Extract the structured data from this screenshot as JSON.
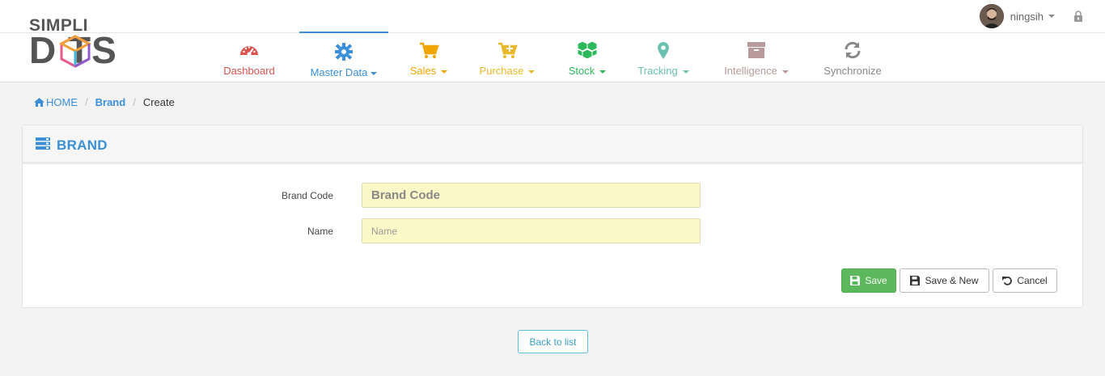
{
  "logo": {
    "line1": "SIMPLI",
    "line2": "D  TS"
  },
  "user": {
    "name": "ningsih"
  },
  "nav": {
    "items": [
      {
        "label": "Dashboard",
        "color": "#d9534f",
        "icon": "dashboard-gauge-icon",
        "dropdown": false
      },
      {
        "label": "Master Data",
        "color": "#3a8fd6",
        "icon": "gear-icon",
        "dropdown": true
      },
      {
        "label": "Sales",
        "color": "#f0a500",
        "icon": "cart-icon",
        "dropdown": true
      },
      {
        "label": "Purchase",
        "color": "#e8b92c",
        "icon": "cart-plus-icon",
        "dropdown": true
      },
      {
        "label": "Stock",
        "color": "#2db85c",
        "icon": "cubes-icon",
        "dropdown": true
      },
      {
        "label": "Tracking",
        "color": "#6cc0b0",
        "icon": "map-marker-icon",
        "dropdown": true
      },
      {
        "label": "Intelligence",
        "color": "#b89a9a",
        "icon": "archive-box-icon",
        "dropdown": true
      },
      {
        "label": "Synchronize",
        "color": "#888888",
        "icon": "refresh-icon",
        "dropdown": false
      }
    ]
  },
  "breadcrumb": {
    "home": "HOME",
    "section": "Brand",
    "current": "Create"
  },
  "panel": {
    "title": "BRAND"
  },
  "form": {
    "brand_code": {
      "label": "Brand Code",
      "placeholder": "Brand Code",
      "value": ""
    },
    "name": {
      "label": "Name",
      "placeholder": "Name",
      "value": ""
    }
  },
  "buttons": {
    "save": "Save",
    "save_new": "Save & New",
    "cancel": "Cancel",
    "back": "Back to list"
  }
}
